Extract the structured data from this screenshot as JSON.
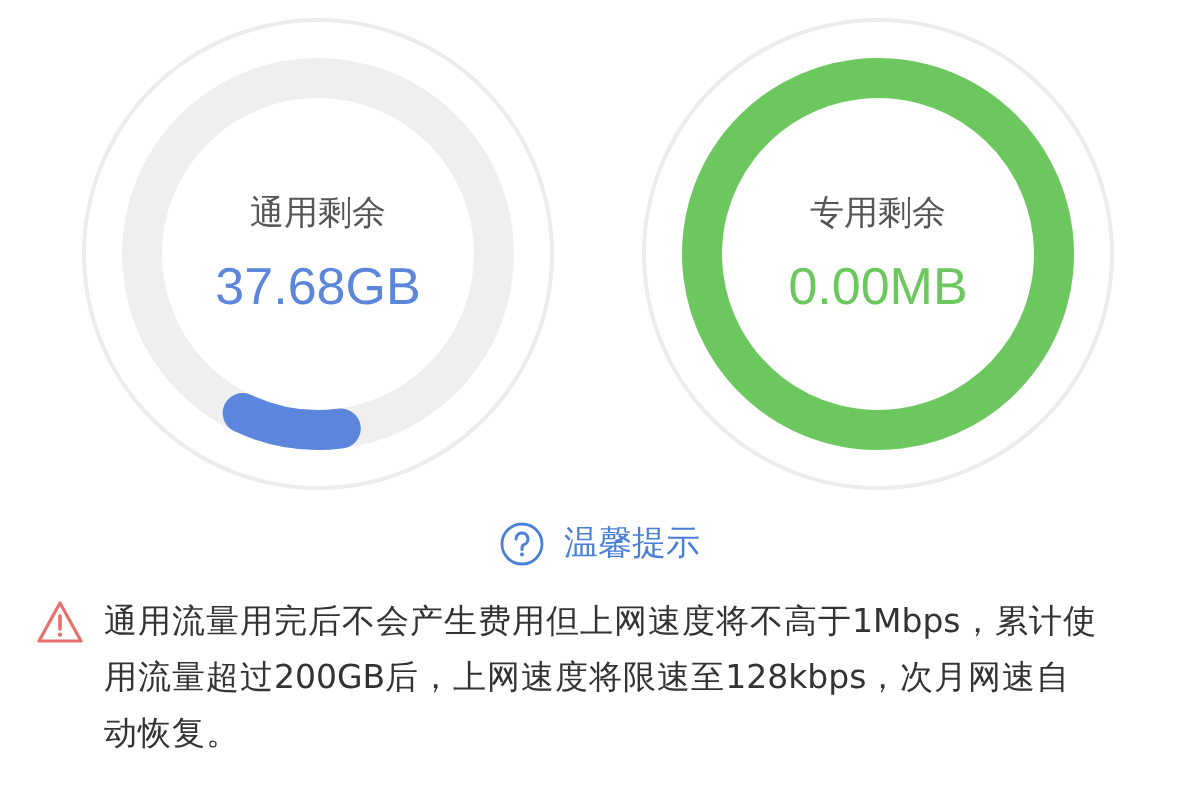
{
  "gauges": [
    {
      "label": "通用剩余",
      "value": "37.68GB",
      "level": 0.09,
      "color": "#5b86db"
    },
    {
      "label": "专用剩余",
      "value": "0.00MB",
      "level": 1,
      "color": "#6cc75f"
    }
  ],
  "tip": {
    "title": "温馨提示"
  },
  "warning": {
    "text": "通用流量用完后不会产生费用但上网速度将不高于1Mbps，累计使用流量超过200GB后，上网速度将限速至128kbps，次月网速自动恢复。"
  }
}
